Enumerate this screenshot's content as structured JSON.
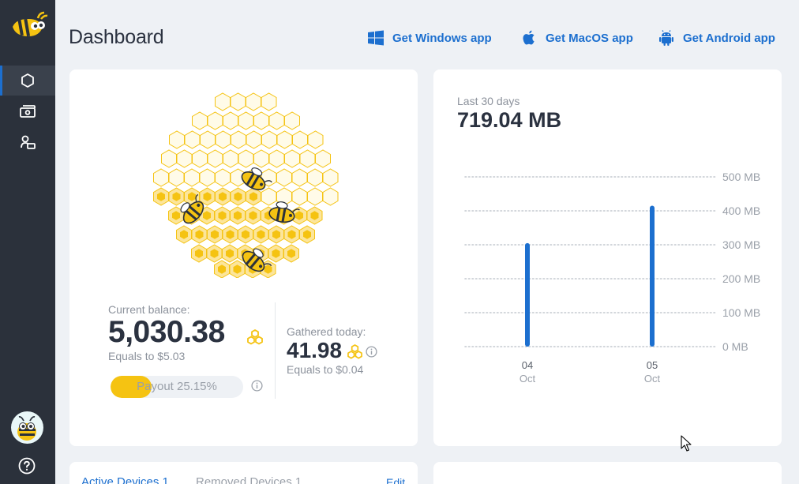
{
  "header": {
    "title": "Dashboard",
    "apps": [
      {
        "label": "Get Windows app",
        "icon": "windows-icon"
      },
      {
        "label": "Get MacOS app",
        "icon": "apple-icon"
      },
      {
        "label": "Get Android app",
        "icon": "android-icon"
      }
    ]
  },
  "sidebar": {
    "items": [
      {
        "icon": "hexagon-icon",
        "active": true
      },
      {
        "icon": "cash-icon",
        "active": false
      },
      {
        "icon": "devices-icon",
        "active": false
      }
    ],
    "avatar_icon": "bee-avatar",
    "help_icon": "help-icon"
  },
  "balance": {
    "label": "Current balance:",
    "value": "5,030.38",
    "equals": "Equals to $5.03",
    "payout_label": "Payout 25.15%",
    "payout_fraction": 0.2515
  },
  "gathered": {
    "label": "Gathered today:",
    "value": "41.98",
    "equals": "Equals to $0.04"
  },
  "traffic": {
    "range_label": "Last 30 days",
    "total": "719.04 MB"
  },
  "chart_data": {
    "type": "bar",
    "categories": [
      [
        "04",
        "Oct"
      ],
      [
        "05",
        "Oct"
      ]
    ],
    "values": [
      305,
      415
    ],
    "unit": "MB",
    "ylim": [
      0,
      500
    ],
    "yticks": [
      "0 MB",
      "100 MB",
      "200 MB",
      "300 MB",
      "400 MB",
      "500 MB"
    ],
    "grid": true,
    "color": "#1c6fcf"
  },
  "devices": {
    "tabs": [
      {
        "label": "Active Devices 1",
        "active": true
      },
      {
        "label": "Removed Devices 1",
        "active": false
      }
    ],
    "edit_label": "Edit"
  },
  "colors": {
    "accent": "#1c6fcf",
    "honey": "#f5c312",
    "sidebar": "#2b313b"
  }
}
